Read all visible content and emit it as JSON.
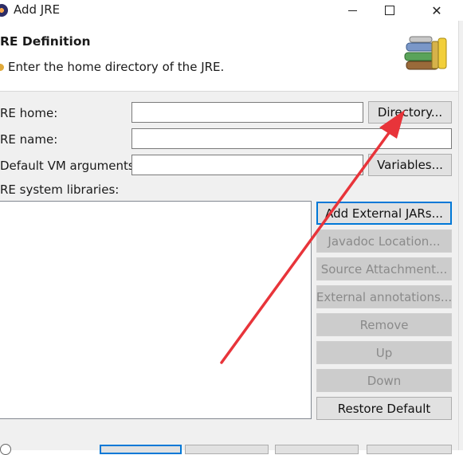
{
  "window": {
    "title": "Add JRE",
    "close_glyph": "✕"
  },
  "header": {
    "title": "RE Definition",
    "message": "Enter the home directory of the JRE."
  },
  "form": {
    "jre_home_label": "RE home:",
    "jre_home_value": "",
    "directory_button": "Directory...",
    "jre_name_label": "RE name:",
    "jre_name_value": "",
    "vm_args_label": "Default VM arguments:",
    "vm_args_value": "",
    "variables_button": "Variables...",
    "libraries_label": "RE system libraries:"
  },
  "library_buttons": [
    {
      "label": "Add External JARs...",
      "enabled": true
    },
    {
      "label": "Javadoc Location...",
      "enabled": false
    },
    {
      "label": "Source Attachment...",
      "enabled": false
    },
    {
      "label": "External annotations...",
      "enabled": false
    },
    {
      "label": "Remove",
      "enabled": false
    },
    {
      "label": "Up",
      "enabled": false
    },
    {
      "label": "Down",
      "enabled": false
    },
    {
      "label": "Restore Default",
      "enabled": true
    }
  ],
  "annotation": {
    "color": "#e8343a"
  }
}
